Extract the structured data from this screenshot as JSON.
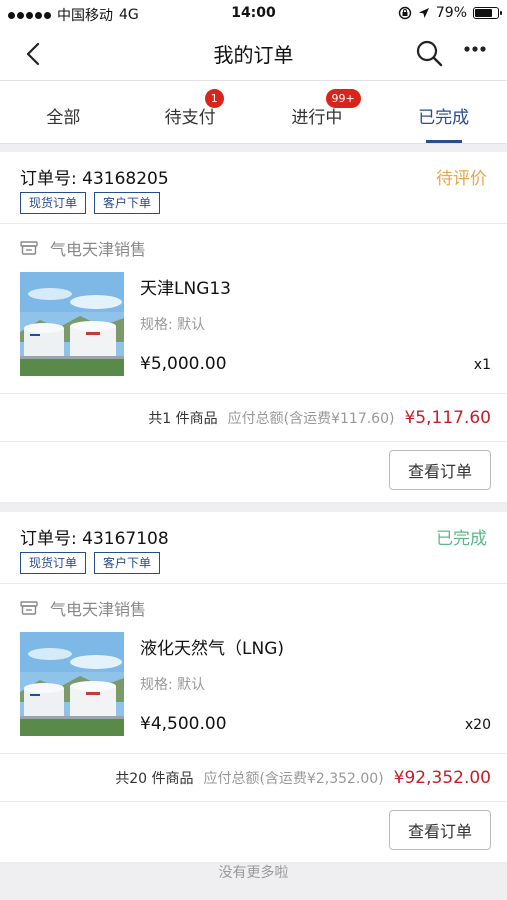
{
  "status_bar": {
    "carrier": "中国移动",
    "network": "4G",
    "time": "14:00",
    "battery": "79%",
    "battery_level": 0.79
  },
  "nav": {
    "title": "我的订单",
    "back_icon": "chevron-left-icon",
    "search_icon": "search-icon",
    "more_icon": "more-dots-icon"
  },
  "tabs": [
    {
      "label": "全部",
      "badge": ""
    },
    {
      "label": "待支付",
      "badge": "1"
    },
    {
      "label": "进行中",
      "badge": "99+"
    },
    {
      "label": "已完成",
      "badge": ""
    }
  ],
  "active_tab": "已完成",
  "colors": {
    "accent": "#2a4d8f",
    "badge": "#d9241b",
    "price_red": "#c81e2a",
    "status_pending_review": "#e3a84a",
    "status_completed": "#5cb88a"
  },
  "orders": [
    {
      "order_label": "订单号: 43168205",
      "status": "待评价",
      "tags": [
        "现货订单",
        "客户下单"
      ],
      "shop": "气电天津销售",
      "product_name": "天津LNG13",
      "spec": "规格: 默认",
      "price": "¥5,000.00",
      "qty": "x1",
      "count_text": "共1 件商品",
      "total_label": "应付总额(含运费¥117.60)",
      "total_amount": "¥5,117.60",
      "button": "查看订单"
    },
    {
      "order_label": "订单号: 43167108",
      "status": "已完成",
      "tags": [
        "现货订单",
        "客户下单"
      ],
      "shop": "气电天津销售",
      "product_name": "液化天然气（LNG)",
      "spec": "规格: 默认",
      "price": "¥4,500.00",
      "qty": "x20",
      "count_text": "共20 件商品",
      "total_label": "应付总额(含运费¥2,352.00)",
      "total_amount": "¥92,352.00",
      "button": "查看订单"
    }
  ],
  "footer": "没有更多啦"
}
